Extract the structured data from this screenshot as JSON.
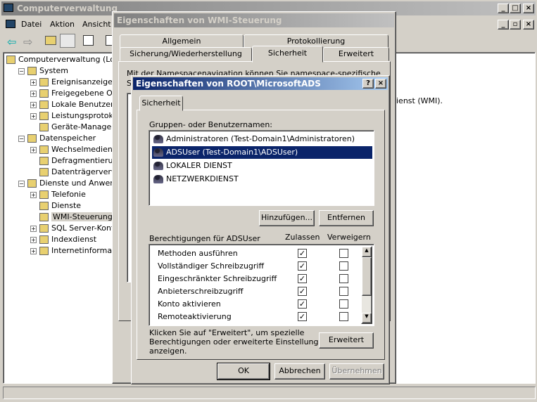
{
  "main": {
    "title": "Computerverwaltung",
    "menu": [
      "Datei",
      "Aktion",
      "Ansicht"
    ],
    "tree": [
      {
        "label": "Computerverwaltung (Lokal)",
        "level": 0,
        "exp": ""
      },
      {
        "label": "System",
        "level": 1,
        "exp": "-"
      },
      {
        "label": "Ereignisanzeige",
        "level": 2,
        "exp": "+"
      },
      {
        "label": "Freigegebene Ordner",
        "level": 2,
        "exp": "+"
      },
      {
        "label": "Lokale Benutzer und Gruppen",
        "level": 2,
        "exp": "+"
      },
      {
        "label": "Leistungsprotokolle und Warnungen",
        "level": 2,
        "exp": "+"
      },
      {
        "label": "Geräte-Manager",
        "level": 2,
        "exp": ""
      },
      {
        "label": "Datenspeicher",
        "level": 1,
        "exp": "-"
      },
      {
        "label": "Wechselmedien",
        "level": 2,
        "exp": "+"
      },
      {
        "label": "Defragmentierung",
        "level": 2,
        "exp": ""
      },
      {
        "label": "Datenträgerverwaltung",
        "level": 2,
        "exp": ""
      },
      {
        "label": "Dienste und Anwendungen",
        "level": 1,
        "exp": "-"
      },
      {
        "label": "Telefonie",
        "level": 2,
        "exp": "+"
      },
      {
        "label": "Dienste",
        "level": 2,
        "exp": ""
      },
      {
        "label": "WMI-Steuerung",
        "level": 2,
        "exp": "",
        "selected": true
      },
      {
        "label": "SQL Server-Konfiguration",
        "level": 2,
        "exp": "+"
      },
      {
        "label": "Indexdienst",
        "level": 2,
        "exp": "+"
      },
      {
        "label": "Internetinformationsdienste",
        "level": 2,
        "exp": "+"
      }
    ],
    "right_text": "ienst (WMI)."
  },
  "wmi": {
    "title": "Eigenschaften von WMI-Steuerung",
    "tabs_row1": [
      "Allgemein",
      "Protokollierung"
    ],
    "tabs_row2": [
      "Sicherung/Wiederherstellung",
      "Sicherheit",
      "Erweitert"
    ],
    "text1": "Mit der Namespacenavigation können Sie namespace-spezifische",
    "text2": "S"
  },
  "root": {
    "title": "Eigenschaften von ROOT\\MicrosoftADS",
    "help": "?",
    "close": "×",
    "tab": "Sicherheit",
    "groups_label": "Gruppen- oder Benutzernamen:",
    "users": [
      "Administratoren (Test-Domain1\\Administratoren)",
      "ADSUser (Test-Domain1\\ADSUser)",
      "LOKALER DIENST",
      "NETZWERKDIENST"
    ],
    "add": "Hinzufügen...",
    "remove": "Entfernen",
    "perm_label": "Berechtigungen für ADSUser",
    "allow": "Zulassen",
    "deny": "Verweigern",
    "perms": [
      {
        "name": "Methoden ausführen",
        "allow": true,
        "deny": false
      },
      {
        "name": "Vollständiger Schreibzugriff",
        "allow": true,
        "deny": false
      },
      {
        "name": "Eingeschränkter Schreibzugriff",
        "allow": true,
        "deny": false
      },
      {
        "name": "Anbieterschreibzugriff",
        "allow": true,
        "deny": false
      },
      {
        "name": "Konto aktivieren",
        "allow": true,
        "deny": false
      },
      {
        "name": "Remoteaktivierung",
        "allow": true,
        "deny": false
      }
    ],
    "adv_text": [
      "Klicken Sie auf \"Erweitert\", um spezielle",
      "Berechtigungen oder erweiterte Einstellungen",
      "anzeigen."
    ],
    "advanced": "Erweitert",
    "ok": "OK",
    "cancel": "Abbrechen",
    "apply": "Übernehmen"
  }
}
